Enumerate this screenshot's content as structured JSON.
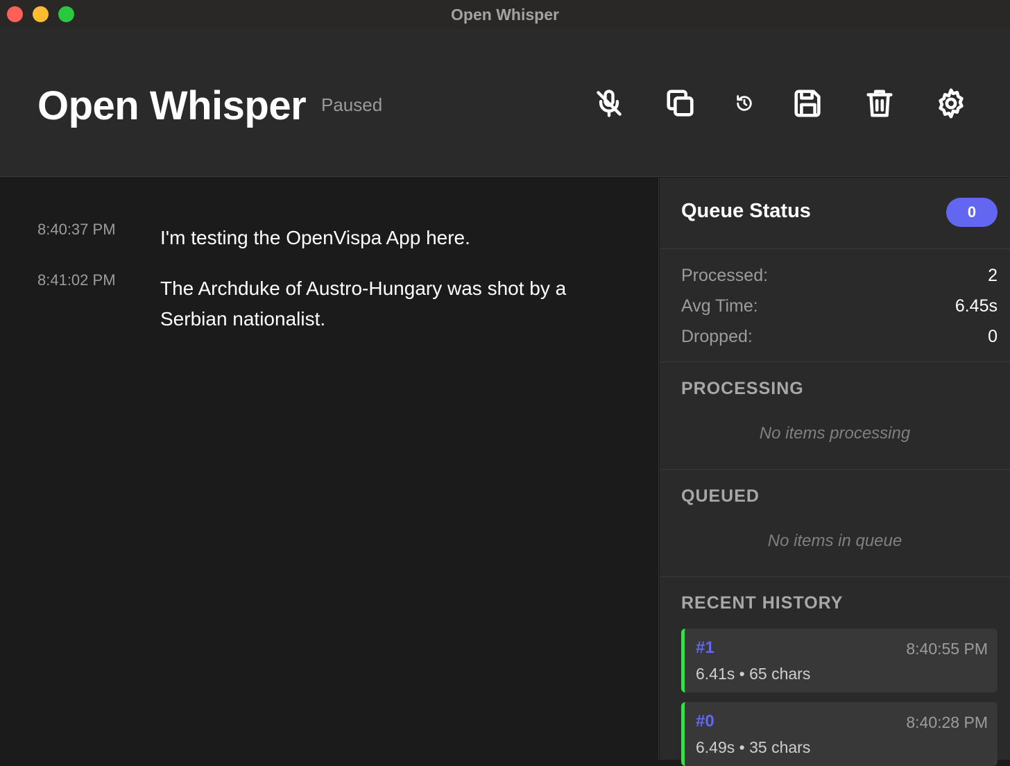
{
  "window": {
    "title": "Open Whisper"
  },
  "header": {
    "app_title": "Open Whisper",
    "status": "Paused",
    "toolbar": [
      {
        "name": "mute-mic-button",
        "icon": "microphone-off-icon"
      },
      {
        "name": "copy-button",
        "icon": "copy-icon"
      },
      {
        "name": "reset-button",
        "icon": "rotate-ccw-icon"
      },
      {
        "name": "save-button",
        "icon": "save-icon"
      },
      {
        "name": "delete-button",
        "icon": "trash-icon"
      },
      {
        "name": "settings-button",
        "icon": "gear-icon"
      }
    ]
  },
  "transcript": [
    {
      "time": "8:40:37 PM",
      "text": "I'm testing the OpenVispa App here."
    },
    {
      "time": "8:41:02 PM",
      "text": "The Archduke of Austro-Hungary was shot by a Serbian nationalist."
    }
  ],
  "queue": {
    "title": "Queue Status",
    "badge": "0",
    "stats": [
      {
        "label": "Processed:",
        "value": "2"
      },
      {
        "label": "Avg Time:",
        "value": "6.45s"
      },
      {
        "label": "Dropped:",
        "value": "0"
      }
    ],
    "processing": {
      "heading": "PROCESSING",
      "empty": "No items processing"
    },
    "queued": {
      "heading": "QUEUED",
      "empty": "No items in queue"
    },
    "history": {
      "heading": "RECENT HISTORY",
      "items": [
        {
          "id": "#1",
          "time": "8:40:55 PM",
          "meta": "6.41s • 65 chars"
        },
        {
          "id": "#0",
          "time": "8:40:28 PM",
          "meta": "6.49s • 35 chars"
        }
      ]
    }
  },
  "colors": {
    "accent": "#6366f1",
    "success": "#3ddc50",
    "background": "#1b1b1b",
    "panel": "#2a2a2a"
  }
}
